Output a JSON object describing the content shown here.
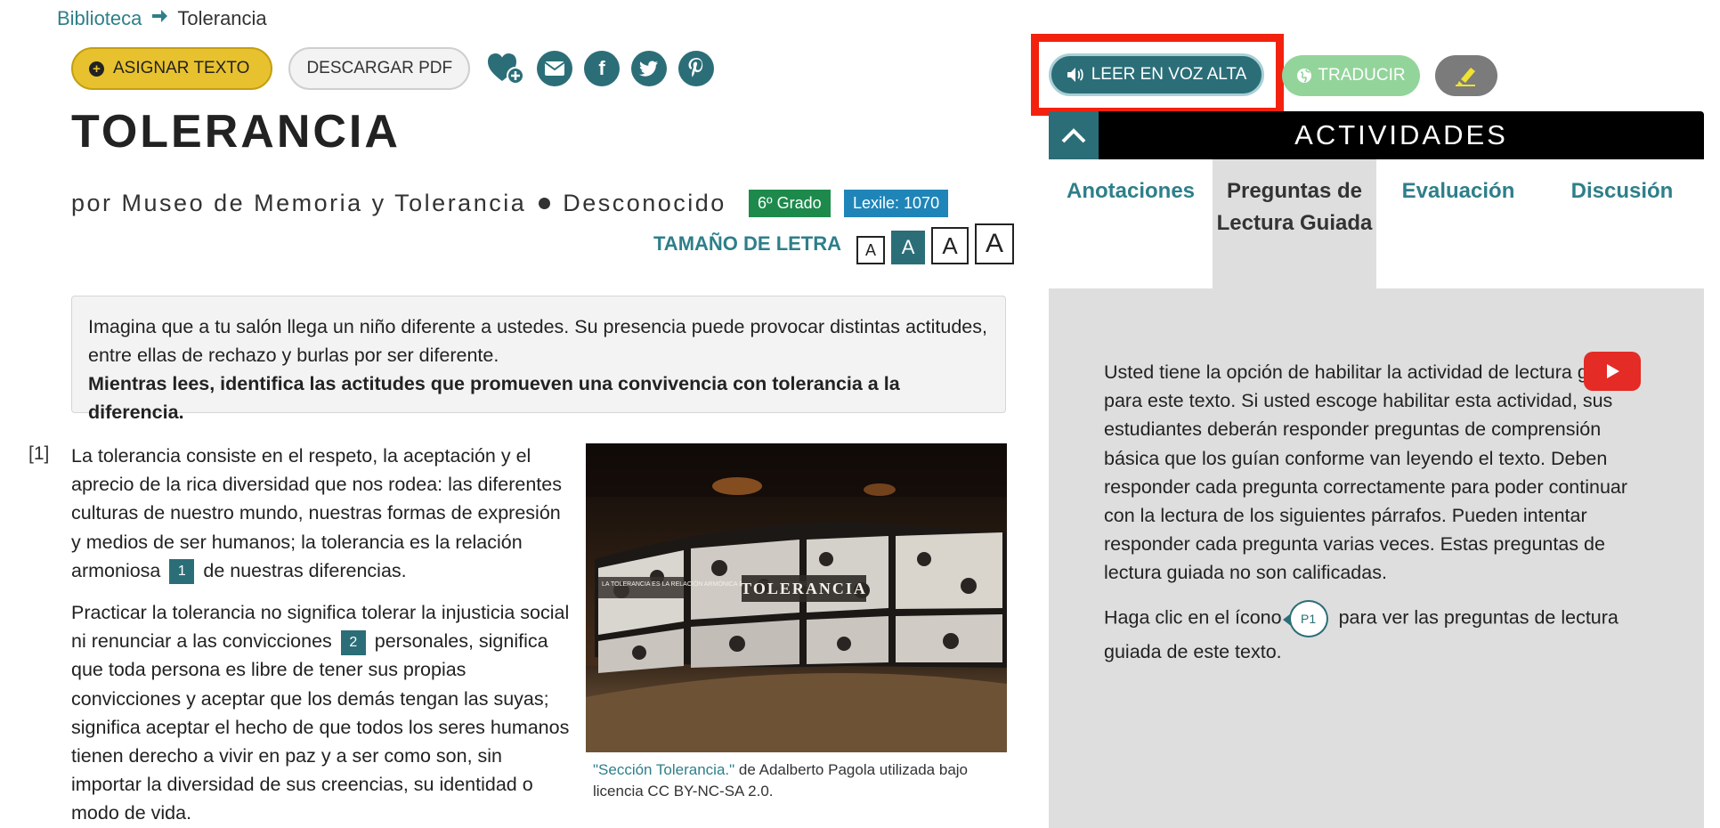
{
  "breadcrumb": {
    "library": "Biblioteca",
    "current": "Tolerancia"
  },
  "toolbar": {
    "assign_label": "ASIGNAR TEXTO",
    "download_label": "DESCARGAR PDF",
    "share_icons": [
      "heart-plus-icon",
      "email-icon",
      "facebook-icon",
      "twitter-icon",
      "pinterest-icon"
    ]
  },
  "title": "TOLERANCIA",
  "byline": {
    "prefix": "por",
    "author": "Museo de Memoria y Tolerancia",
    "date": "Desconocido"
  },
  "badges": {
    "grade": "6º Grado",
    "lexile": "Lexile: 1070"
  },
  "font_size": {
    "label": "TAMAÑO DE LETRA",
    "options": [
      "A",
      "A",
      "A",
      "A"
    ],
    "selected_index": 1
  },
  "intro": {
    "text": "Imagina que a tu salón llega un niño diferente a ustedes. Su presencia puede provocar distintas actitudes, entre ellas de rechazo y burlas por ser diferente.",
    "bold": "Mientras lees, identifica las actitudes que promueven una convivencia con tolerancia a la diferencia."
  },
  "article": {
    "para_number": "[1]",
    "p1_a": "La tolerancia consiste en el respeto, la aceptación y el aprecio de la rica diversidad que nos rodea: las diferentes culturas de nuestro mundo, nuestras formas de expresión y medios de ser humanos; la tolerancia es la relación armoniosa",
    "fn1": "1",
    "p1_b": "de nuestras diferencias.",
    "p2_a": "Practicar la tolerancia no significa tolerar la injusticia social ni renunciar a las convicciones",
    "fn2": "2",
    "p2_b": "personales, significa que toda persona es libre de tener sus propias convicciones y aceptar que los demás tengan las suyas; significa aceptar el hecho de que todos los seres humanos tienen derecho a vivir en paz y a ser como son, sin importar la diversidad de sus creencias, su identidad o modo de vida."
  },
  "figure": {
    "photo_text_left": "LA TOLERANCIA ES LA RELACIÓN ARMÓNICA DE NUESTRAS DIFERENCIAS",
    "photo_text_center": "TOLERANCIA",
    "caption_link": "\"Sección Tolerancia.\"",
    "caption_rest": "de Adalberto Pagola utilizada bajo licencia CC BY-NC-SA 2.0."
  },
  "right_toolbar": {
    "read_aloud_label": "LEER EN VOZ ALTA",
    "translate_label": "TRADUCIR",
    "highlight_icon": "highlighter-icon"
  },
  "activities": {
    "title": "ACTIVIDADES",
    "tabs": [
      "Anotaciones",
      "Preguntas de Lectura Guiada",
      "Evaluación",
      "Discusión"
    ],
    "active_tab_index": 1,
    "body_p1": "Usted tiene la opción de habilitar la actividad de lectura guiada para este texto. Si usted escoge habilitar esta actividad, sus estudiantes deberán responder preguntas de comprensión básica que los guían conforme van leyendo el texto. Deben responder cada pregunta correctamente para poder continuar con la lectura de los siguientes párrafos. Pueden intentar responder cada pregunta varias veces. Estas preguntas de lectura guiada no son calificadas.",
    "body_p2_a": "Haga clic en el ícono",
    "marker_label": "P1",
    "body_p2_b": "para ver las preguntas de lectura guiada de este texto."
  },
  "colors": {
    "teal": "#2b6e78",
    "link": "#2e7f8a",
    "assign_yellow": "#e8c22e",
    "grade_green": "#1d8a4c",
    "lexile_blue": "#1f85b8",
    "translate_green": "#93d49b",
    "highlight_red": "#f2220f",
    "youtube_red": "#e42b26"
  }
}
